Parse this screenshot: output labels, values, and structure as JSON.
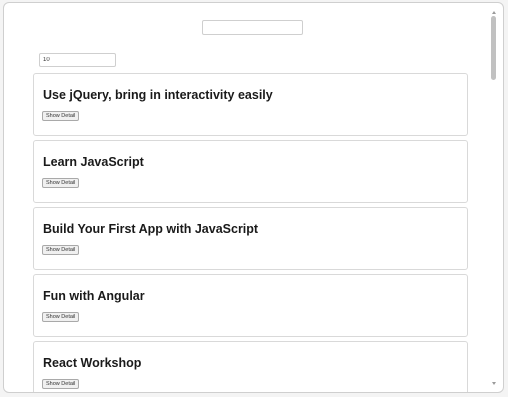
{
  "search": {
    "value": "",
    "placeholder": ""
  },
  "count_input": {
    "value": "10"
  },
  "cards": [
    {
      "title": "Use jQuery, bring in interactivity easily",
      "button_label": "Show Detail"
    },
    {
      "title": "Learn JavaScript",
      "button_label": "Show Detail"
    },
    {
      "title": "Build Your First App with JavaScript",
      "button_label": "Show Detail"
    },
    {
      "title": "Fun with Angular",
      "button_label": "Show Detail"
    },
    {
      "title": "React Workshop",
      "button_label": "Show Detail"
    }
  ],
  "colors": {
    "page_background": "#ffffff",
    "card_border": "#d9d9d9",
    "title_text": "#1a1a1a"
  }
}
